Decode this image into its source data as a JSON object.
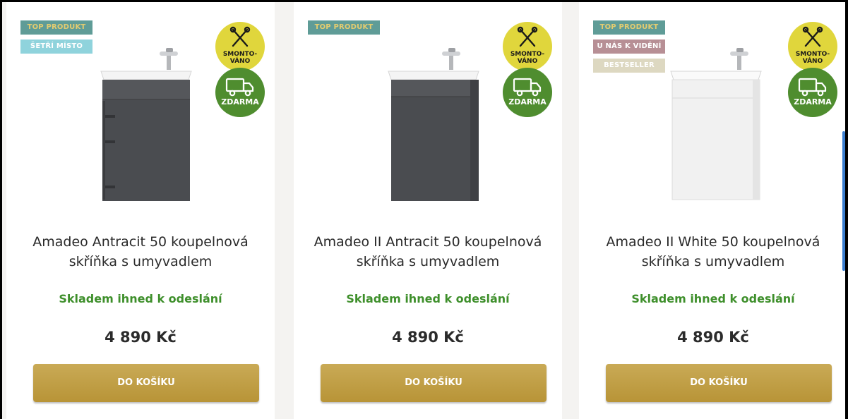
{
  "products": [
    {
      "badges": [
        "TOP PRODUKT",
        "ŠETŘÍ MÍSTO"
      ],
      "circle_assembled": "SMONTO-\nVÁNO",
      "circle_free": "ZDARMA",
      "title_line1": "Amadeo Antracit 50 koupelnová",
      "title_line2": "skříňka s umyvadlem",
      "stock": "Skladem ihned k odeslání",
      "price": "4 890 Kč",
      "button": "DO KOŠÍKU",
      "cabinet_color": "#4a4c50"
    },
    {
      "badges": [
        "TOP PRODUKT"
      ],
      "circle_assembled": "SMONTO-\nVÁNO",
      "circle_free": "ZDARMA",
      "title_line1": "Amadeo II Antracit 50 koupelnová",
      "title_line2": "skříňka s umyvadlem",
      "stock": "Skladem ihned k odeslání",
      "price": "4 890 Kč",
      "button": "DO KOŠÍKU",
      "cabinet_color": "#4a4c50"
    },
    {
      "badges": [
        "TOP PRODUKT",
        "U NÁS K VIDĚNÍ",
        "BESTSELLER"
      ],
      "circle_assembled": "SMONTO-\nVÁNO",
      "circle_free": "ZDARMA",
      "title_line1": "Amadeo II White 50 koupelnová",
      "title_line2": "skříňka s umyvadlem",
      "stock": "Skladem ihned k odeslání",
      "price": "4 890 Kč",
      "button": "DO KOŠÍKU",
      "cabinet_color": "#f1f1f1"
    }
  ],
  "icons": {
    "assembled": "tools-icon",
    "free_delivery": "truck-icon"
  },
  "colors": {
    "button": "#c0a046",
    "stock_green": "#3e8f2b",
    "badge_top": "#5f9c97",
    "circle_yellow": "#e0d63c",
    "circle_green": "#4f8d2f"
  }
}
